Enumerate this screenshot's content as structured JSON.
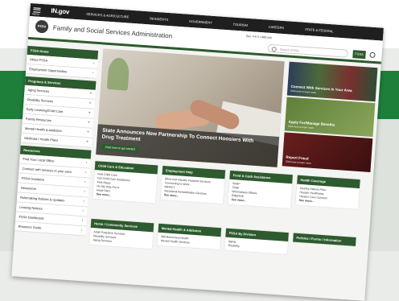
{
  "topnav": {
    "menu_label": "MENU",
    "logo": "IN.gov",
    "links": [
      "SERVICES & AGRICULTURE",
      "RESIDENTS",
      "GOVERNMENT",
      "TOURISM",
      "CAREERS",
      "STATE & FEDERAL"
    ]
  },
  "agency": {
    "seal_text": "FSSA",
    "title": "Family and Social Services Administration",
    "search_placeholder": "Search FSSA",
    "search_scope": "FSSA",
    "top_links": "Sec. 4 & 5 | 988 Link"
  },
  "sidebar": {
    "sections": [
      {
        "heading": "FSSA Home",
        "items": [
          "About FSSA",
          "Employment Opportunities"
        ]
      },
      {
        "heading": "Programs & Services",
        "items": [
          "Aging Services",
          "Disability Services",
          "Early Learning/Child Care",
          "Family Resources",
          "Mental Health & Addiction",
          "Medicaid / Health Plans"
        ]
      },
      {
        "heading": "Resources",
        "items": [
          "Find Your Local Office",
          "Connect with services in your area",
          "FSSA Guidance",
          "Newsroom",
          "Rulemaking Notices & Updates",
          "Leasing Notices",
          "FSSA Dashboard",
          "Resource Guide"
        ]
      }
    ]
  },
  "hero": {
    "title": "State Announces New Partnership To Connect Hoosiers With Drug Treatment",
    "button": "Click here to get started"
  },
  "promos": [
    {
      "title": "Connect With Services In Your Area",
      "link": "Click here to learn more"
    },
    {
      "title": "Apply For/Manage Benefits",
      "link": "Click here to learn more"
    },
    {
      "title": "Report Fraud",
      "link": "Click here to learn more"
    }
  ],
  "cards": [
    {
      "heading": "Child Care & Education",
      "items": [
        "Find Child Care",
        "Get Child Care Assistance",
        "First Steps",
        "On My Way Pre-K",
        "Head Start"
      ],
      "more": "See more..."
    },
    {
      "heading": "Employment Help",
      "items": [
        "Blind and Visually Impaired Services",
        "Connecting to Work",
        "IMPACT",
        "Vocational Rehabilitation Services"
      ],
      "more": "See more..."
    },
    {
      "heading": "Food & Cash Assistance",
      "items": [
        "SNAP",
        "TANF",
        "WIC/Indiana Offices",
        "EMERGE"
      ],
      "more": "See more..."
    },
    {
      "heading": "Health Coverage",
      "items": [
        "Healthy Indiana Plan",
        "Hoosier Healthwise",
        "Hoosier Care Connect"
      ],
      "more": "See more..."
    },
    {
      "heading": "Home / Community Services",
      "items": [
        "Adult Protective Services",
        "Disability Services",
        "Aging Services"
      ],
      "more": ""
    },
    {
      "heading": "Mental Health & Addiction",
      "items": [
        "988 Behavioral Health",
        "Mental Health Services"
      ],
      "more": ""
    },
    {
      "heading": "FSSA By Division",
      "items": [
        "Aging",
        "Disability"
      ],
      "more": ""
    },
    {
      "heading": "Policies / Forms / Information",
      "items": [],
      "more": ""
    }
  ]
}
